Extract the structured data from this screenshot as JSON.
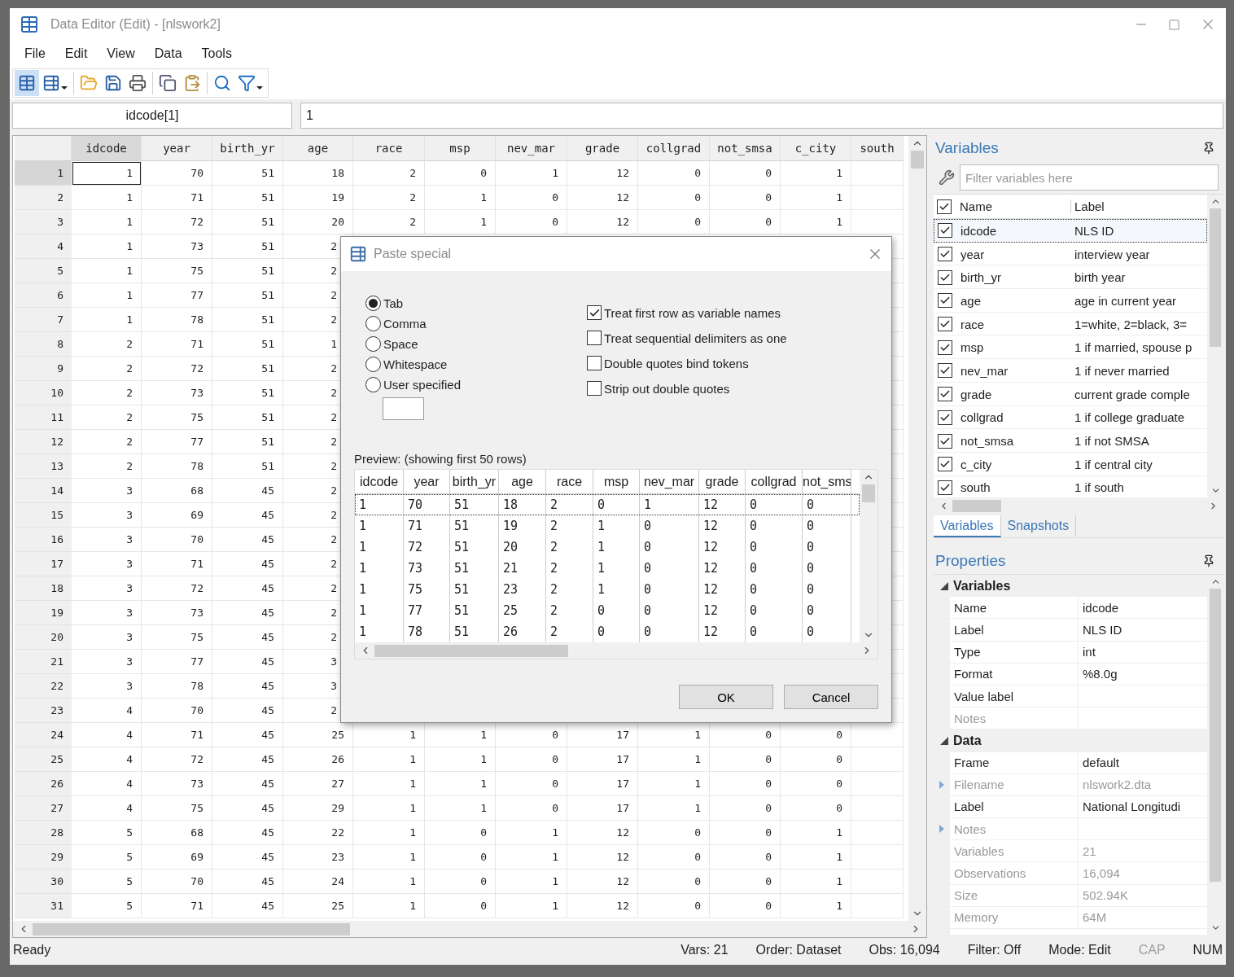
{
  "window": {
    "title": "Data Editor (Edit) - [nlswork2]"
  },
  "menu": [
    "File",
    "Edit",
    "View",
    "Data",
    "Tools"
  ],
  "toolbar": [
    {
      "kind": "edit",
      "selected": true,
      "dropdown": false
    },
    {
      "kind": "browse",
      "selected": false,
      "dropdown": true
    },
    {
      "kind": "open",
      "selected": false,
      "dropdown": false
    },
    {
      "kind": "save",
      "selected": false,
      "dropdown": false
    },
    {
      "kind": "print",
      "selected": false,
      "dropdown": false
    },
    {
      "kind": "copy",
      "selected": false,
      "dropdown": false
    },
    {
      "kind": "paste",
      "selected": false,
      "dropdown": false
    },
    {
      "kind": "find",
      "selected": false,
      "dropdown": false
    },
    {
      "kind": "filter",
      "selected": false,
      "dropdown": true
    }
  ],
  "cell_bar": {
    "name": "idcode[1]",
    "value": "1"
  },
  "grid": {
    "columns": [
      {
        "label": "idcode",
        "selected": true
      },
      {
        "label": "year",
        "selected": false
      },
      {
        "label": "birth_yr",
        "selected": false
      },
      {
        "label": "age",
        "selected": false
      },
      {
        "label": "race",
        "selected": false
      },
      {
        "label": "msp",
        "selected": false
      },
      {
        "label": "nev_mar",
        "selected": false
      },
      {
        "label": "grade",
        "selected": false
      },
      {
        "label": "collgrad",
        "selected": false
      },
      {
        "label": "not_smsa",
        "selected": false
      },
      {
        "label": "c_city",
        "selected": false
      },
      {
        "label": "south",
        "selected": false
      }
    ],
    "rows": [
      {
        "number": "1",
        "selected": true,
        "cells": [
          "1",
          "70",
          "51",
          "18",
          "2",
          "0",
          "1",
          "12",
          "0",
          "0",
          "1"
        ]
      },
      {
        "number": "2",
        "selected": false,
        "cells": [
          "1",
          "71",
          "51",
          "19",
          "2",
          "1",
          "0",
          "12",
          "0",
          "0",
          "1"
        ]
      },
      {
        "number": "3",
        "selected": false,
        "cells": [
          "1",
          "72",
          "51",
          "20",
          "2",
          "1",
          "0",
          "12",
          "0",
          "0",
          "1"
        ]
      },
      {
        "number": "4",
        "selected": false,
        "cells": [
          "1",
          "73",
          "51",
          "2"
        ]
      },
      {
        "number": "5",
        "selected": false,
        "cells": [
          "1",
          "75",
          "51",
          "2"
        ]
      },
      {
        "number": "6",
        "selected": false,
        "cells": [
          "1",
          "77",
          "51",
          "2"
        ]
      },
      {
        "number": "7",
        "selected": false,
        "cells": [
          "1",
          "78",
          "51",
          "2"
        ]
      },
      {
        "number": "8",
        "selected": false,
        "cells": [
          "2",
          "71",
          "51",
          "1"
        ]
      },
      {
        "number": "9",
        "selected": false,
        "cells": [
          "2",
          "72",
          "51",
          "2"
        ]
      },
      {
        "number": "10",
        "selected": false,
        "cells": [
          "2",
          "73",
          "51",
          "2"
        ]
      },
      {
        "number": "11",
        "selected": false,
        "cells": [
          "2",
          "75",
          "51",
          "2"
        ]
      },
      {
        "number": "12",
        "selected": false,
        "cells": [
          "2",
          "77",
          "51",
          "2"
        ]
      },
      {
        "number": "13",
        "selected": false,
        "cells": [
          "2",
          "78",
          "51",
          "2"
        ]
      },
      {
        "number": "14",
        "selected": false,
        "cells": [
          "3",
          "68",
          "45",
          "2"
        ]
      },
      {
        "number": "15",
        "selected": false,
        "cells": [
          "3",
          "69",
          "45",
          "2"
        ]
      },
      {
        "number": "16",
        "selected": false,
        "cells": [
          "3",
          "70",
          "45",
          "2"
        ]
      },
      {
        "number": "17",
        "selected": false,
        "cells": [
          "3",
          "71",
          "45",
          "2"
        ]
      },
      {
        "number": "18",
        "selected": false,
        "cells": [
          "3",
          "72",
          "45",
          "2"
        ]
      },
      {
        "number": "19",
        "selected": false,
        "cells": [
          "3",
          "73",
          "45",
          "2"
        ]
      },
      {
        "number": "20",
        "selected": false,
        "cells": [
          "3",
          "75",
          "45",
          "2"
        ]
      },
      {
        "number": "21",
        "selected": false,
        "cells": [
          "3",
          "77",
          "45",
          "3"
        ]
      },
      {
        "number": "22",
        "selected": false,
        "cells": [
          "3",
          "78",
          "45",
          "3"
        ]
      },
      {
        "number": "23",
        "selected": false,
        "cells": [
          "4",
          "70",
          "45",
          "2"
        ]
      },
      {
        "number": "24",
        "selected": false,
        "cells": [
          "4",
          "71",
          "45",
          "25",
          "1",
          "1",
          "0",
          "17",
          "1",
          "0",
          "0"
        ]
      },
      {
        "number": "25",
        "selected": false,
        "cells": [
          "4",
          "72",
          "45",
          "26",
          "1",
          "1",
          "0",
          "17",
          "1",
          "0",
          "0"
        ]
      },
      {
        "number": "26",
        "selected": false,
        "cells": [
          "4",
          "73",
          "45",
          "27",
          "1",
          "1",
          "0",
          "17",
          "1",
          "0",
          "0"
        ]
      },
      {
        "number": "27",
        "selected": false,
        "cells": [
          "4",
          "75",
          "45",
          "29",
          "1",
          "1",
          "0",
          "17",
          "1",
          "0",
          "0"
        ]
      },
      {
        "number": "28",
        "selected": false,
        "cells": [
          "5",
          "68",
          "45",
          "22",
          "1",
          "0",
          "1",
          "12",
          "0",
          "0",
          "1"
        ]
      },
      {
        "number": "29",
        "selected": false,
        "cells": [
          "5",
          "69",
          "45",
          "23",
          "1",
          "0",
          "1",
          "12",
          "0",
          "0",
          "1"
        ]
      },
      {
        "number": "30",
        "selected": false,
        "cells": [
          "5",
          "70",
          "45",
          "24",
          "1",
          "0",
          "1",
          "12",
          "0",
          "0",
          "1"
        ]
      },
      {
        "number": "31",
        "selected": false,
        "cells": [
          "5",
          "71",
          "45",
          "25",
          "1",
          "0",
          "1",
          "12",
          "0",
          "0",
          "1"
        ]
      }
    ]
  },
  "dialog": {
    "title": "Paste special",
    "delimiters": [
      {
        "label": "Tab",
        "selected": true
      },
      {
        "label": "Comma",
        "selected": false
      },
      {
        "label": "Space",
        "selected": false
      },
      {
        "label": "Whitespace",
        "selected": false
      },
      {
        "label": "User specified",
        "selected": false
      }
    ],
    "options": [
      {
        "label": "Treat first row as variable names",
        "checked": true
      },
      {
        "label": "Treat sequential delimiters as one",
        "checked": false
      },
      {
        "label": "Double quotes bind tokens",
        "checked": false
      },
      {
        "label": "Strip out double quotes",
        "checked": false
      }
    ],
    "preview": {
      "caption": "Preview: (showing first 50 rows)",
      "columns": [
        "idcode",
        "year",
        "birth_yr",
        "age",
        "race",
        "msp",
        "nev_mar",
        "grade",
        "collgrad",
        "not_sms"
      ],
      "rows": [
        [
          "1",
          "70",
          "51",
          "18",
          "2",
          "0",
          "1",
          "12",
          "0",
          "0"
        ],
        [
          "1",
          "71",
          "51",
          "19",
          "2",
          "1",
          "0",
          "12",
          "0",
          "0"
        ],
        [
          "1",
          "72",
          "51",
          "20",
          "2",
          "1",
          "0",
          "12",
          "0",
          "0"
        ],
        [
          "1",
          "73",
          "51",
          "21",
          "2",
          "1",
          "0",
          "12",
          "0",
          "0"
        ],
        [
          "1",
          "75",
          "51",
          "23",
          "2",
          "1",
          "0",
          "12",
          "0",
          "0"
        ],
        [
          "1",
          "77",
          "51",
          "25",
          "2",
          "0",
          "0",
          "12",
          "0",
          "0"
        ],
        [
          "1",
          "78",
          "51",
          "26",
          "2",
          "0",
          "0",
          "12",
          "0",
          "0"
        ]
      ]
    },
    "buttons": [
      "OK",
      "Cancel"
    ]
  },
  "variables": {
    "title": "Variables",
    "filter_placeholder": "Filter variables here",
    "header": {
      "name": "Name",
      "label": "Label",
      "checked": true
    },
    "rows": [
      {
        "name": "idcode",
        "label": "NLS ID",
        "checked": true,
        "selected": true
      },
      {
        "name": "year",
        "label": "interview year",
        "checked": true,
        "selected": false
      },
      {
        "name": "birth_yr",
        "label": "birth year",
        "checked": true,
        "selected": false
      },
      {
        "name": "age",
        "label": "age in current year",
        "checked": true,
        "selected": false
      },
      {
        "name": "race",
        "label": "1=white, 2=black, 3=",
        "checked": true,
        "selected": false
      },
      {
        "name": "msp",
        "label": "1 if married, spouse p",
        "checked": true,
        "selected": false
      },
      {
        "name": "nev_mar",
        "label": "1 if never married",
        "checked": true,
        "selected": false
      },
      {
        "name": "grade",
        "label": "current grade comple",
        "checked": true,
        "selected": false
      },
      {
        "name": "collgrad",
        "label": "1 if college graduate",
        "checked": true,
        "selected": false
      },
      {
        "name": "not_smsa",
        "label": "1 if not SMSA",
        "checked": true,
        "selected": false
      },
      {
        "name": "c_city",
        "label": "1 if central city",
        "checked": true,
        "selected": false
      },
      {
        "name": "south",
        "label": "1 if south",
        "checked": true,
        "selected": false
      }
    ],
    "tabs": [
      {
        "label": "Variables",
        "selected": true
      },
      {
        "label": "Snapshots",
        "selected": false
      }
    ]
  },
  "properties": {
    "title": "Properties",
    "groups": [
      {
        "name": "Variables",
        "expanded": true,
        "rows": [
          {
            "name": "Name",
            "value": "idcode",
            "disabled": false,
            "expandable": false
          },
          {
            "name": "Label",
            "value": "NLS ID",
            "disabled": false,
            "expandable": false
          },
          {
            "name": "Type",
            "value": "int",
            "disabled": false,
            "expandable": false
          },
          {
            "name": "Format",
            "value": "%8.0g",
            "disabled": false,
            "expandable": false
          },
          {
            "name": "Value label",
            "disabled": false,
            "expandable": false
          },
          {
            "name": "Notes",
            "disabled": true,
            "expandable": false
          }
        ]
      },
      {
        "name": "Data",
        "expanded": true,
        "rows": [
          {
            "name": "Frame",
            "value": "default",
            "disabled": false,
            "expandable": false
          },
          {
            "name": "Filename",
            "value": "nlswork2.dta",
            "disabled": true,
            "expandable": true
          },
          {
            "name": "Label",
            "value": "National Longitudi",
            "disabled": false,
            "expandable": false
          },
          {
            "name": "Notes",
            "disabled": true,
            "expandable": true
          },
          {
            "name": "Variables",
            "value": "21",
            "disabled": true,
            "expandable": false
          },
          {
            "name": "Observations",
            "value": "16,094",
            "disabled": true,
            "expandable": false
          },
          {
            "name": "Size",
            "value": "502.94K",
            "disabled": true,
            "expandable": false
          },
          {
            "name": "Memory",
            "value": "64M",
            "disabled": true,
            "expandable": false
          }
        ]
      }
    ]
  },
  "status_bar": {
    "message": "Ready",
    "items": [
      {
        "text": "Vars: 21",
        "disabled": false
      },
      {
        "text": "Order: Dataset",
        "disabled": false
      },
      {
        "text": "Obs: 16,094",
        "disabled": false
      },
      {
        "text": "Filter: Off",
        "disabled": false
      },
      {
        "text": "Mode: Edit",
        "disabled": false
      },
      {
        "text": "CAP",
        "disabled": true
      },
      {
        "text": "NUM",
        "disabled": false
      }
    ]
  }
}
